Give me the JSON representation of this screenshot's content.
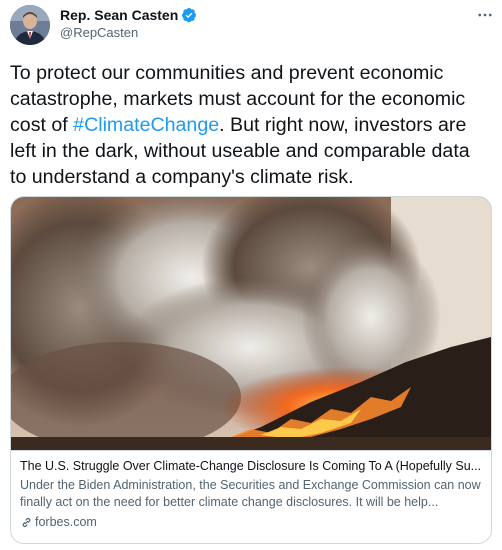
{
  "author": {
    "name": "Rep. Sean Casten",
    "handle": "@RepCasten",
    "verified": true
  },
  "tweet": {
    "text_before": "To protect our communities and prevent economic catastrophe, markets must account for the economic cost of ",
    "hashtag": "#ClimateChange",
    "text_after": ". But right now, investors are left in the dark, without useable and comparable data to understand a company's climate risk."
  },
  "link_card": {
    "image_icon": "wildfire-photo",
    "title": "The U.S. Struggle Over Climate-Change Disclosure Is Coming To A (Hopefully Su...",
    "description": "Under the Biden Administration, the Securities and Exchange Commission can now finally act on the need for better climate change disclosures. It will be help...",
    "domain": "forbes.com"
  },
  "colors": {
    "accent": "#1d9bf0",
    "text": "#0f1419",
    "secondary_text": "#536471",
    "border": "#cfd9de"
  },
  "icons": {
    "verified": "verified-badge-icon",
    "more": "more-icon",
    "link": "link-icon"
  }
}
